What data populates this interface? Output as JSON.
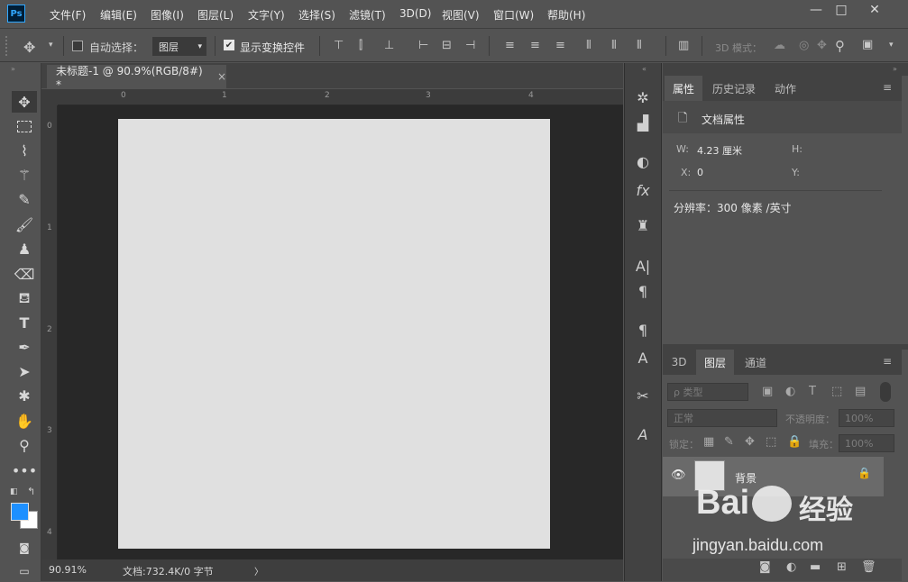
{
  "app": {
    "logo": "Ps"
  },
  "menubar": {
    "items": [
      "文件(F)",
      "编辑(E)",
      "图像(I)",
      "图层(L)",
      "文字(Y)",
      "选择(S)",
      "滤镜(T)",
      "3D(D)",
      "视图(V)",
      "窗口(W)",
      "帮助(H)"
    ],
    "window_buttons": {
      "minimize": "—",
      "maximize": "□",
      "close": "✕"
    }
  },
  "options": {
    "auto_select_label": "自动选择：",
    "auto_select_target": "图层",
    "show_transform_label": "显示变换控件",
    "mode_3d_label": "3D 模式："
  },
  "document": {
    "tab_title": "未标题-1 @ 90.9%(RGB/8#) *",
    "tab_close": "×",
    "h_ruler": [
      "0",
      "1",
      "2",
      "3",
      "4"
    ],
    "v_ruler": [
      "0",
      "1",
      "2",
      "3",
      "4"
    ],
    "zoom": "90.91%",
    "status": "文档:732.4K/0 字节",
    "status_arrow": "〉"
  },
  "properties": {
    "tabs": [
      "属性",
      "历史记录",
      "动作"
    ],
    "title": "文档属性",
    "w_label": "W:",
    "w_value": "4.23 厘米",
    "h_label": "H:",
    "x_label": "X:",
    "x_value": "0",
    "y_label": "Y:",
    "resolution": "分辨率：300 像素 /英寸"
  },
  "layers": {
    "tabs": [
      "3D",
      "图层",
      "通道"
    ],
    "filter_kind": "ρ 类型",
    "blend_mode": "正常",
    "opacity_label": "不透明度：",
    "opacity_value": "100%",
    "lock_label": "锁定：",
    "fill_label": "填充：",
    "fill_value": "100%",
    "layer_name": "背景"
  },
  "watermark": {
    "brand": "Bai",
    "brand2": "经验",
    "url": "jingyan.baidu.com"
  },
  "colors": {
    "foreground": "#1e90ff",
    "background": "#ffffff",
    "accent": "#31a8ff"
  }
}
